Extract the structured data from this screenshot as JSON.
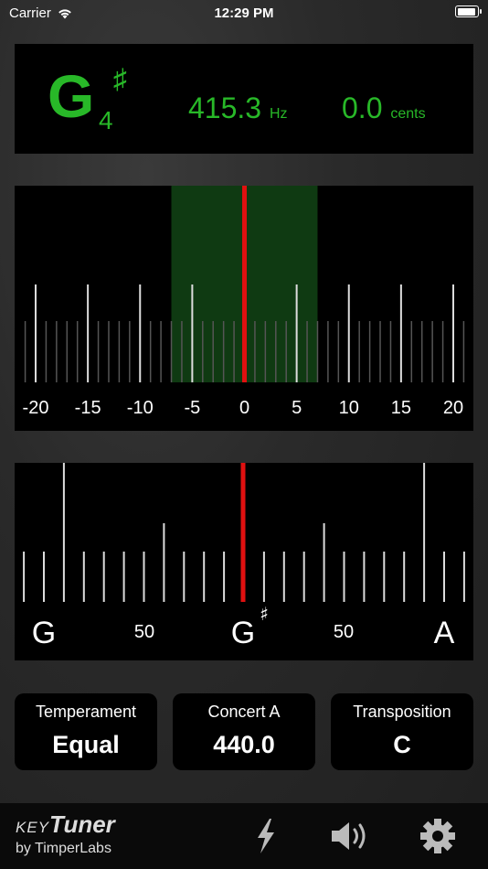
{
  "status_bar": {
    "carrier": "Carrier",
    "time": "12:29 PM"
  },
  "note_display": {
    "letter": "G",
    "accidental": "♯",
    "octave": "4",
    "frequency": "415.3",
    "frequency_unit": "Hz",
    "cents": "0.0",
    "cents_unit": "cents"
  },
  "cents_scale": {
    "labels": [
      "-20",
      "-15",
      "-10",
      "-5",
      "0",
      "5",
      "10",
      "15",
      "20"
    ],
    "in_tune_range": [
      -7,
      7
    ],
    "needle_value": 0
  },
  "note_scale": {
    "labels": [
      {
        "text": "G",
        "big": true
      },
      {
        "text": "50",
        "big": false
      },
      {
        "text": "G",
        "big": true,
        "sharp": "♯"
      },
      {
        "text": "50",
        "big": false
      },
      {
        "text": "A",
        "big": true
      }
    ]
  },
  "settings": {
    "temperament": {
      "label": "Temperament",
      "value": "Equal"
    },
    "concert_a": {
      "label": "Concert A",
      "value": "440.0"
    },
    "transposition": {
      "label": "Transposition",
      "value": "C"
    }
  },
  "branding": {
    "key": "KEY",
    "tuner": "Tuner",
    "by": "by TimperLabs"
  },
  "colors": {
    "green": "#28b828",
    "needle": "#e01010",
    "band": "#0f3a12"
  },
  "icons": [
    "wifi-icon",
    "battery-icon",
    "lightning-icon",
    "speaker-icon",
    "gear-icon"
  ]
}
